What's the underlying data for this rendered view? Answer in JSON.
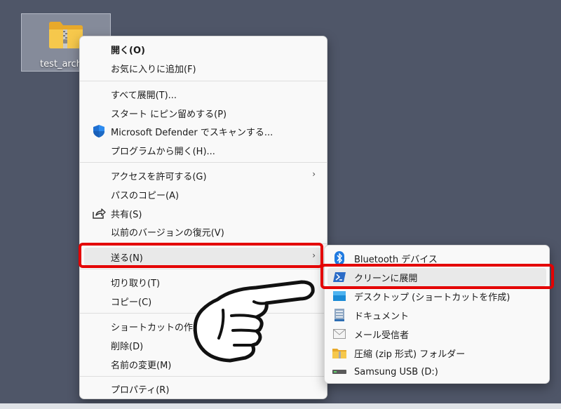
{
  "desktop": {
    "icon_label": "test_arch",
    "background": "#4f5668"
  },
  "main_menu": {
    "items": [
      {
        "label": "開く(O)"
      },
      {
        "label": "お気に入りに追加(F)"
      },
      {
        "label": "すべて展開(T)..."
      },
      {
        "label": "スタート にピン留めする(P)"
      },
      {
        "label": "Microsoft Defender でスキャンする..."
      },
      {
        "label": "プログラムから開く(H)..."
      },
      {
        "label": "アクセスを許可する(G)"
      },
      {
        "label": "パスのコピー(A)"
      },
      {
        "label": "共有(S)"
      },
      {
        "label": "以前のバージョンの復元(V)"
      },
      {
        "label": "送る(N)"
      },
      {
        "label": "切り取り(T)"
      },
      {
        "label": "コピー(C)"
      },
      {
        "label": "ショートカットの作成(S)"
      },
      {
        "label": "削除(D)"
      },
      {
        "label": "名前の変更(M)"
      },
      {
        "label": "プロパティ(R)"
      }
    ],
    "arrow": "›"
  },
  "send_to_menu": {
    "items": [
      {
        "label": "Bluetooth デバイス",
        "icon": "bluetooth-icon"
      },
      {
        "label": "クリーンに展開",
        "icon": "powershell-icon"
      },
      {
        "label": "デスクトップ (ショートカットを作成)",
        "icon": "desktop-icon"
      },
      {
        "label": "ドキュメント",
        "icon": "documents-icon"
      },
      {
        "label": "メール受信者",
        "icon": "mail-icon"
      },
      {
        "label": "圧縮 (zip 形式) フォルダー",
        "icon": "zip-folder-icon"
      },
      {
        "label": "Samsung USB (D:)",
        "icon": "usb-drive-icon"
      }
    ]
  },
  "annotations": {
    "callout_color": "#e40000"
  }
}
